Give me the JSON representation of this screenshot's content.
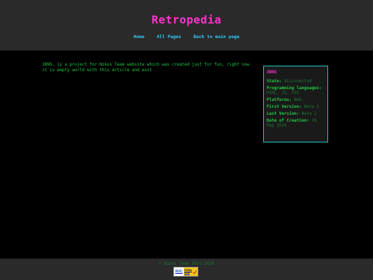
{
  "header": {
    "site_title": "Retropedia",
    "nav": [
      {
        "label": "Home"
      },
      {
        "label": "All Pages"
      },
      {
        "label": "Back to main page"
      }
    ]
  },
  "article": {
    "intro": "3DNS, is a project for Nikos Team website which was created just for fun, right now it is empty world with this article and exit"
  },
  "infobox": {
    "title": "3DNS",
    "rows": [
      {
        "label": "State",
        "value": "Disconected"
      },
      {
        "label": "Programming languages",
        "value": "HTML, JS, CSS"
      },
      {
        "label": "Platforms",
        "value": "Web"
      },
      {
        "label": "First Version",
        "value": "Beta 1"
      },
      {
        "label": "Last Version",
        "value": "Beta 2"
      },
      {
        "label": "Date of Creation",
        "value": "28 May 2024"
      }
    ]
  },
  "footer": {
    "copyright": "© Nikos Team 2021-2024",
    "badge": {
      "w3c": "W3C",
      "html": "HTML",
      "version": "4.01"
    }
  },
  "colors": {
    "background": "#000000",
    "bar": "#2a2a2a",
    "title": "#ff33cc",
    "nav": "#33ccff",
    "text": "#22cc44",
    "muted": "#1b7a30",
    "border": "#22cccc"
  }
}
